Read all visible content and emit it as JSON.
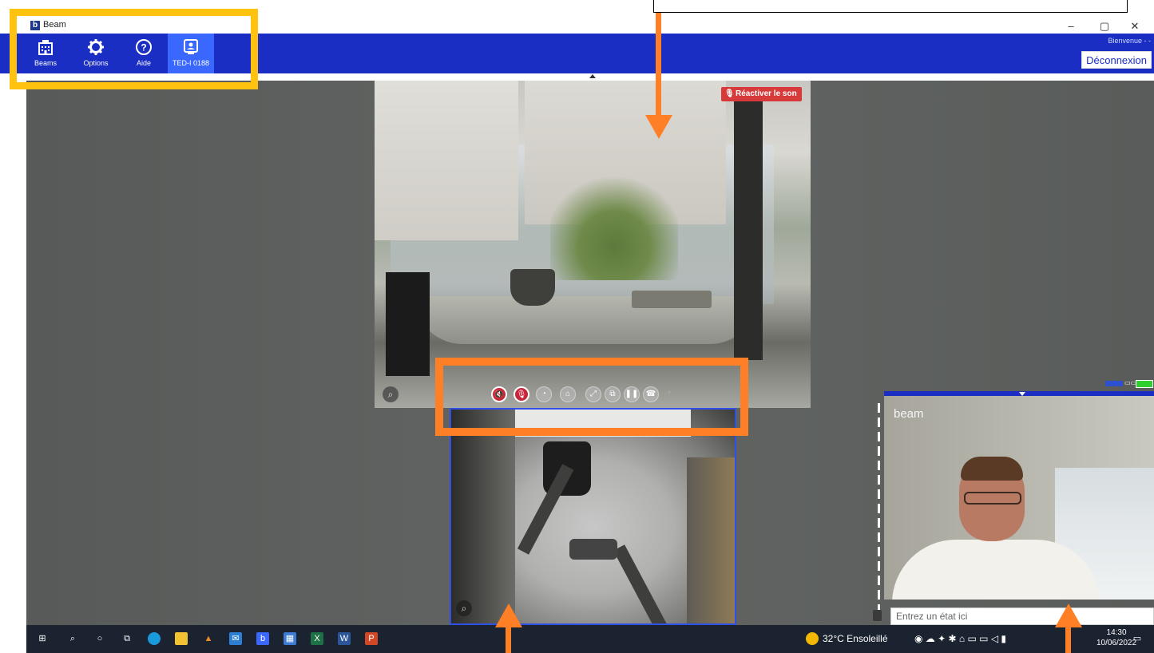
{
  "window": {
    "title": "Beam",
    "logo_letter": "b",
    "minimize": "–",
    "restore": "▢",
    "close": "✕"
  },
  "nav": {
    "items": [
      {
        "label": "Beams",
        "icon": "building-icon"
      },
      {
        "label": "Options",
        "icon": "gear-icon"
      },
      {
        "label": "Aide",
        "icon": "help-icon"
      },
      {
        "label": "TED-I 0188",
        "icon": "robot-icon",
        "active": true
      }
    ],
    "welcome": "Bienvenue - -",
    "logout_label": "Déconnexion"
  },
  "main_video": {
    "unmute_label": "Réactiver le son"
  },
  "toolbar": {
    "buttons": [
      {
        "name": "speaker-muted",
        "style": "red"
      },
      {
        "name": "mic-muted",
        "style": "red"
      },
      {
        "name": "speed",
        "style": "grey"
      },
      {
        "name": "park",
        "style": "grey"
      },
      {
        "name": "fullscreen",
        "style": "grey"
      },
      {
        "name": "swap",
        "style": "grey"
      },
      {
        "name": "pause",
        "style": "grey"
      },
      {
        "name": "hang-up",
        "style": "grey"
      },
      {
        "name": "add",
        "style": "grey"
      }
    ]
  },
  "self_view": {
    "brand": "beam",
    "status_placeholder": "Entrez un état ici"
  },
  "taskbar": {
    "weather": "32°C Ensoleillé",
    "time": "14:30",
    "date": "10/06/2022",
    "apps": [
      "windows",
      "search",
      "cortana",
      "task-view",
      "edge",
      "explorer",
      "vlc",
      "mail",
      "beam",
      "store",
      "excel",
      "word",
      "powerpoint"
    ]
  },
  "colors": {
    "nav_bg": "#1a2ec4",
    "nav_active": "#3a68ff",
    "highlight_yellow": "#ffc20e",
    "highlight_orange": "#ff7f27",
    "mute_red": "#c8263a"
  }
}
